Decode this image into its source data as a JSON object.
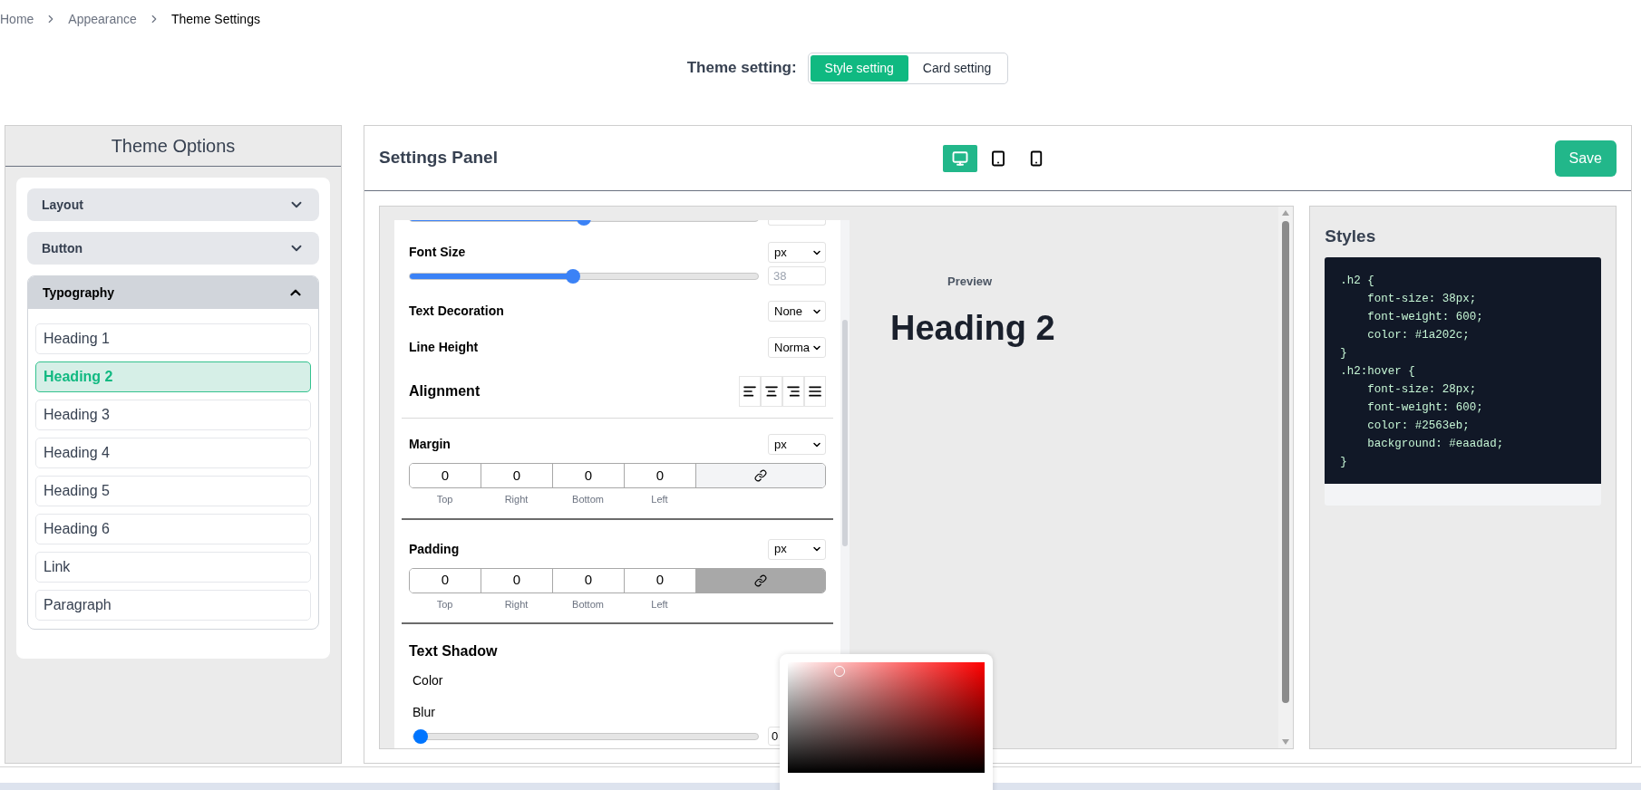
{
  "breadcrumb": [
    {
      "label": "Home",
      "current": false
    },
    {
      "label": "Appearance",
      "current": false
    },
    {
      "label": "Theme Settings",
      "current": true
    }
  ],
  "theme_setting": {
    "label": "Theme setting:",
    "tabs": [
      {
        "label": "Style setting",
        "selected": true
      },
      {
        "label": "Card setting",
        "selected": false
      }
    ]
  },
  "theme_options": {
    "title": "Theme Options",
    "sections": [
      {
        "label": "Layout",
        "expanded": false
      },
      {
        "label": "Button",
        "expanded": false
      },
      {
        "label": "Typography",
        "expanded": true,
        "items": [
          {
            "label": "Heading 1",
            "selected": false
          },
          {
            "label": "Heading 2",
            "selected": true
          },
          {
            "label": "Heading 3",
            "selected": false
          },
          {
            "label": "Heading 4",
            "selected": false
          },
          {
            "label": "Heading 5",
            "selected": false
          },
          {
            "label": "Heading 6",
            "selected": false
          },
          {
            "label": "Link",
            "selected": false
          },
          {
            "label": "Paragraph",
            "selected": false
          }
        ]
      }
    ]
  },
  "settings_panel": {
    "title": "Settings Panel",
    "devices": [
      {
        "kind": "desktop",
        "selected": true
      },
      {
        "kind": "tablet",
        "selected": false
      },
      {
        "kind": "phone",
        "selected": false
      }
    ],
    "save_button": "Save"
  },
  "controls": {
    "partial_slider": {
      "level": 0.5
    },
    "font_size": {
      "label": "Font Size",
      "unit": "px",
      "level": 0.47,
      "placeholder": "38"
    },
    "text_decoration": {
      "label": "Text Decoration",
      "value": "None"
    },
    "line_height": {
      "label": "Line Height",
      "value": "Norma"
    },
    "alignment": {
      "label": "Alignment",
      "options": [
        {
          "kind": "left"
        },
        {
          "kind": "center"
        },
        {
          "kind": "right"
        },
        {
          "kind": "justify"
        }
      ]
    },
    "spacing": [
      {
        "label": "Margin",
        "unit": "px",
        "linked": false,
        "sides": [
          {
            "value": "0",
            "label": "Top"
          },
          {
            "value": "0",
            "label": "Right"
          },
          {
            "value": "0",
            "label": "Bottom"
          },
          {
            "value": "0",
            "label": "Left"
          }
        ]
      },
      {
        "label": "Padding",
        "unit": "px",
        "linked": true,
        "sides": [
          {
            "value": "0",
            "label": "Top"
          },
          {
            "value": "0",
            "label": "Right"
          },
          {
            "value": "0",
            "label": "Bottom"
          },
          {
            "value": "0",
            "label": "Left"
          }
        ]
      }
    ],
    "text_shadow": {
      "title": "Text Shadow",
      "color_label": "Color",
      "blur": {
        "label": "Blur",
        "level": 0,
        "value": "0"
      }
    }
  },
  "preview": {
    "label": "Preview",
    "heading": "Heading 2"
  },
  "styles": {
    "title": "Styles",
    "code_lines": [
      ".h2 {",
      "    font-size: 38px;",
      "    font-weight: 600;",
      "    color: #1a202c;",
      "}",
      ".h2:hover {",
      "    font-size: 28px;",
      "    font-weight: 600;",
      "    color: #2563eb;",
      "    background: #eaadad;",
      "}"
    ]
  }
}
